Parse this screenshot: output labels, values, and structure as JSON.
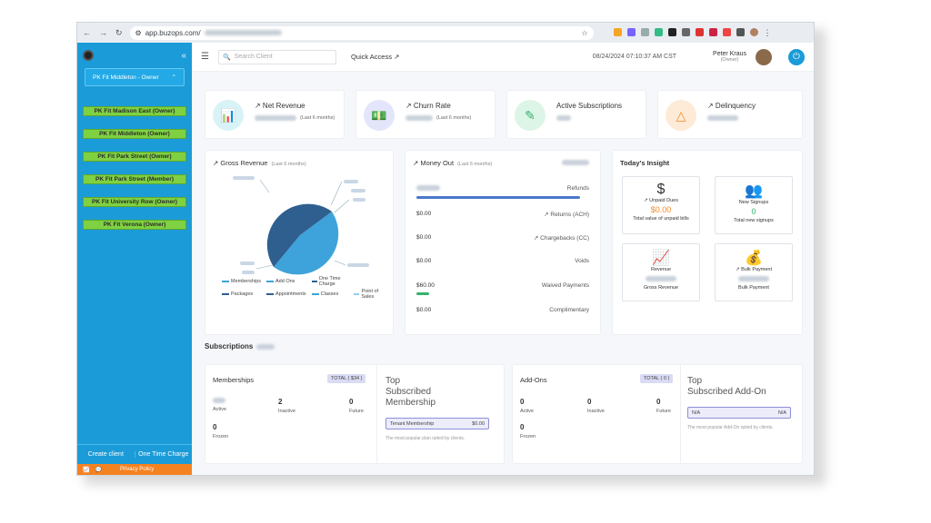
{
  "browser": {
    "url": "app.buzops.com/"
  },
  "sidebar": {
    "location_select": "PK Fit Middleton - Owner",
    "locations": [
      "PK Fit Madison East (Owner)",
      "PK Fit Middleton (Owner)",
      "PK Fit Park Street (Owner)",
      "PK Fit Park Street (Member)",
      "PK Fit University Row (Owner)",
      "PK Fit Verona (Owner)"
    ],
    "create_client": "Create client",
    "one_time_charge": "One Time Charge",
    "privacy_policy": "Privacy Policy"
  },
  "topbar": {
    "search_placeholder": "Search Client",
    "quick_access": "Quick Access ↗",
    "datetime": "08/24/2024 07:10:37 AM CST",
    "user_name": "Peter Kraus",
    "user_role": "(Owner)"
  },
  "kpis": {
    "net_revenue": {
      "title": "↗ Net Revenue",
      "period": "(Last 6 months)"
    },
    "churn_rate": {
      "title": "↗ Churn Rate",
      "period": "(Last 6 months)"
    },
    "active_subscriptions": {
      "title": "Active Subscriptions"
    },
    "delinquency": {
      "title": "↗ Delinquency"
    }
  },
  "gross_revenue": {
    "title": "↗ Gross Revenue",
    "period": "(Last 6 months)",
    "legend": [
      "Memberships",
      "Add Ons",
      "One Time Charge",
      "Packages",
      "Appointments",
      "Classes",
      "Point of Sales"
    ],
    "colors": {
      "dark": "#2f5f8f",
      "light": "#3ea3da"
    }
  },
  "money_out": {
    "title": "↗ Money Out",
    "period": "(Last 6 months)",
    "rows": [
      {
        "amount": "",
        "label": "Refunds"
      },
      {
        "amount": "$0.00",
        "label": "↗ Returns (ACH)"
      },
      {
        "amount": "$0.00",
        "label": "↗ Chargebacks (CC)"
      },
      {
        "amount": "$0.00",
        "label": "Voids"
      },
      {
        "amount": "$60.00",
        "label": "Waived Payments"
      },
      {
        "amount": "$0.00",
        "label": "Complimentary"
      }
    ]
  },
  "insight": {
    "title": "Today's Insight",
    "unpaid_dues": {
      "title": "↗ Unpaid Dues",
      "value": "$0.00",
      "desc": "Total value of unpaid bills"
    },
    "new_signups": {
      "title": "New Signups",
      "value": "0",
      "desc": "Total new signups"
    },
    "revenue": {
      "title": "Revenue",
      "desc": "Gross Revenue"
    },
    "bulk_payment": {
      "title": "↗ Bulk Payment",
      "desc": "Bulk Payment"
    }
  },
  "subscriptions": {
    "heading": "Subscriptions",
    "memberships": {
      "title": "Memberships",
      "total": "TOTAL ( $34 )",
      "active_label": "Active",
      "inactive_value": "2",
      "inactive_label": "Inactive",
      "future_value": "0",
      "future_label": "Future",
      "frozen_value": "0",
      "frozen_label": "Frozen"
    },
    "top_membership": {
      "title_1": "Top",
      "title_2": "Subscribed",
      "title_3": "Membership",
      "name": "Tenant Membership",
      "amount": "$0.00",
      "note": "The most popular plan opted by clients."
    },
    "addons": {
      "title": "Add-Ons",
      "total": "TOTAL ( 0 )",
      "active_value": "0",
      "active_label": "Active",
      "inactive_value": "0",
      "inactive_label": "Inactive",
      "future_value": "0",
      "future_label": "Future",
      "frozen_value": "0",
      "frozen_label": "Frozen"
    },
    "top_addon": {
      "title_1": "Top",
      "title_2": "Subscribed Add-On",
      "name": "N/A",
      "amount": "N/A",
      "note": "The most popular Add-On opted by clients."
    }
  }
}
